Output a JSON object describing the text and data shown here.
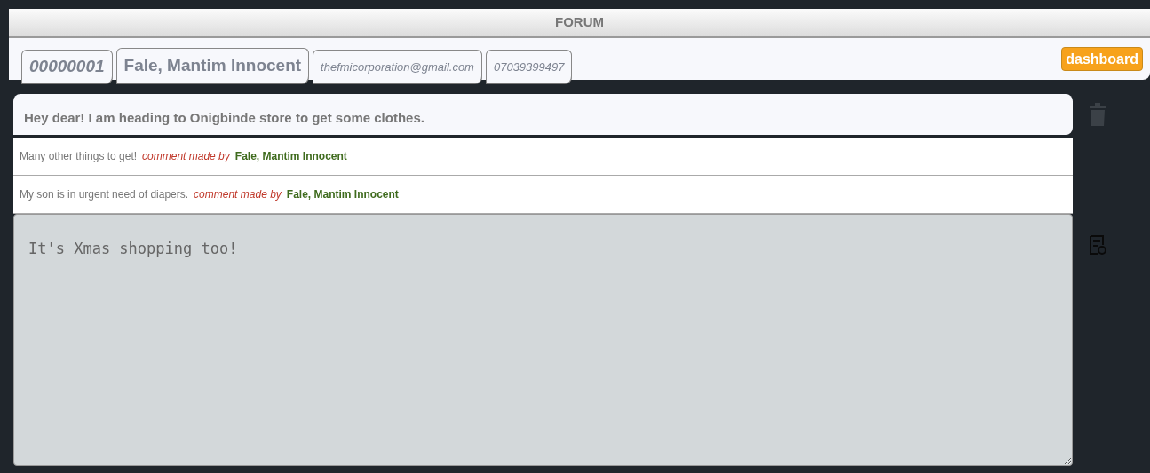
{
  "header": {
    "title": "FORUM"
  },
  "profile_tabs": [
    {
      "text": "00000001",
      "kind": "id"
    },
    {
      "text": "Fale, Mantim Innocent",
      "kind": "name"
    },
    {
      "text": "thefmicorporation@gmail.com",
      "kind": "small"
    },
    {
      "text": "07039399497",
      "kind": "small"
    }
  ],
  "dashboard_button": "dashboard",
  "post": {
    "text": "Hey dear! I am heading to Onigbinde store to get some clothes."
  },
  "comments": [
    {
      "text": "Many other things to get!",
      "by_label": "comment made by",
      "author": "Fale, Mantim Innocent"
    },
    {
      "text": "My son is in urgent need of diapers.",
      "by_label": "comment made by",
      "author": "Fale, Mantim Innocent"
    }
  ],
  "reply_box": {
    "value": "It's Xmas shopping too!"
  }
}
